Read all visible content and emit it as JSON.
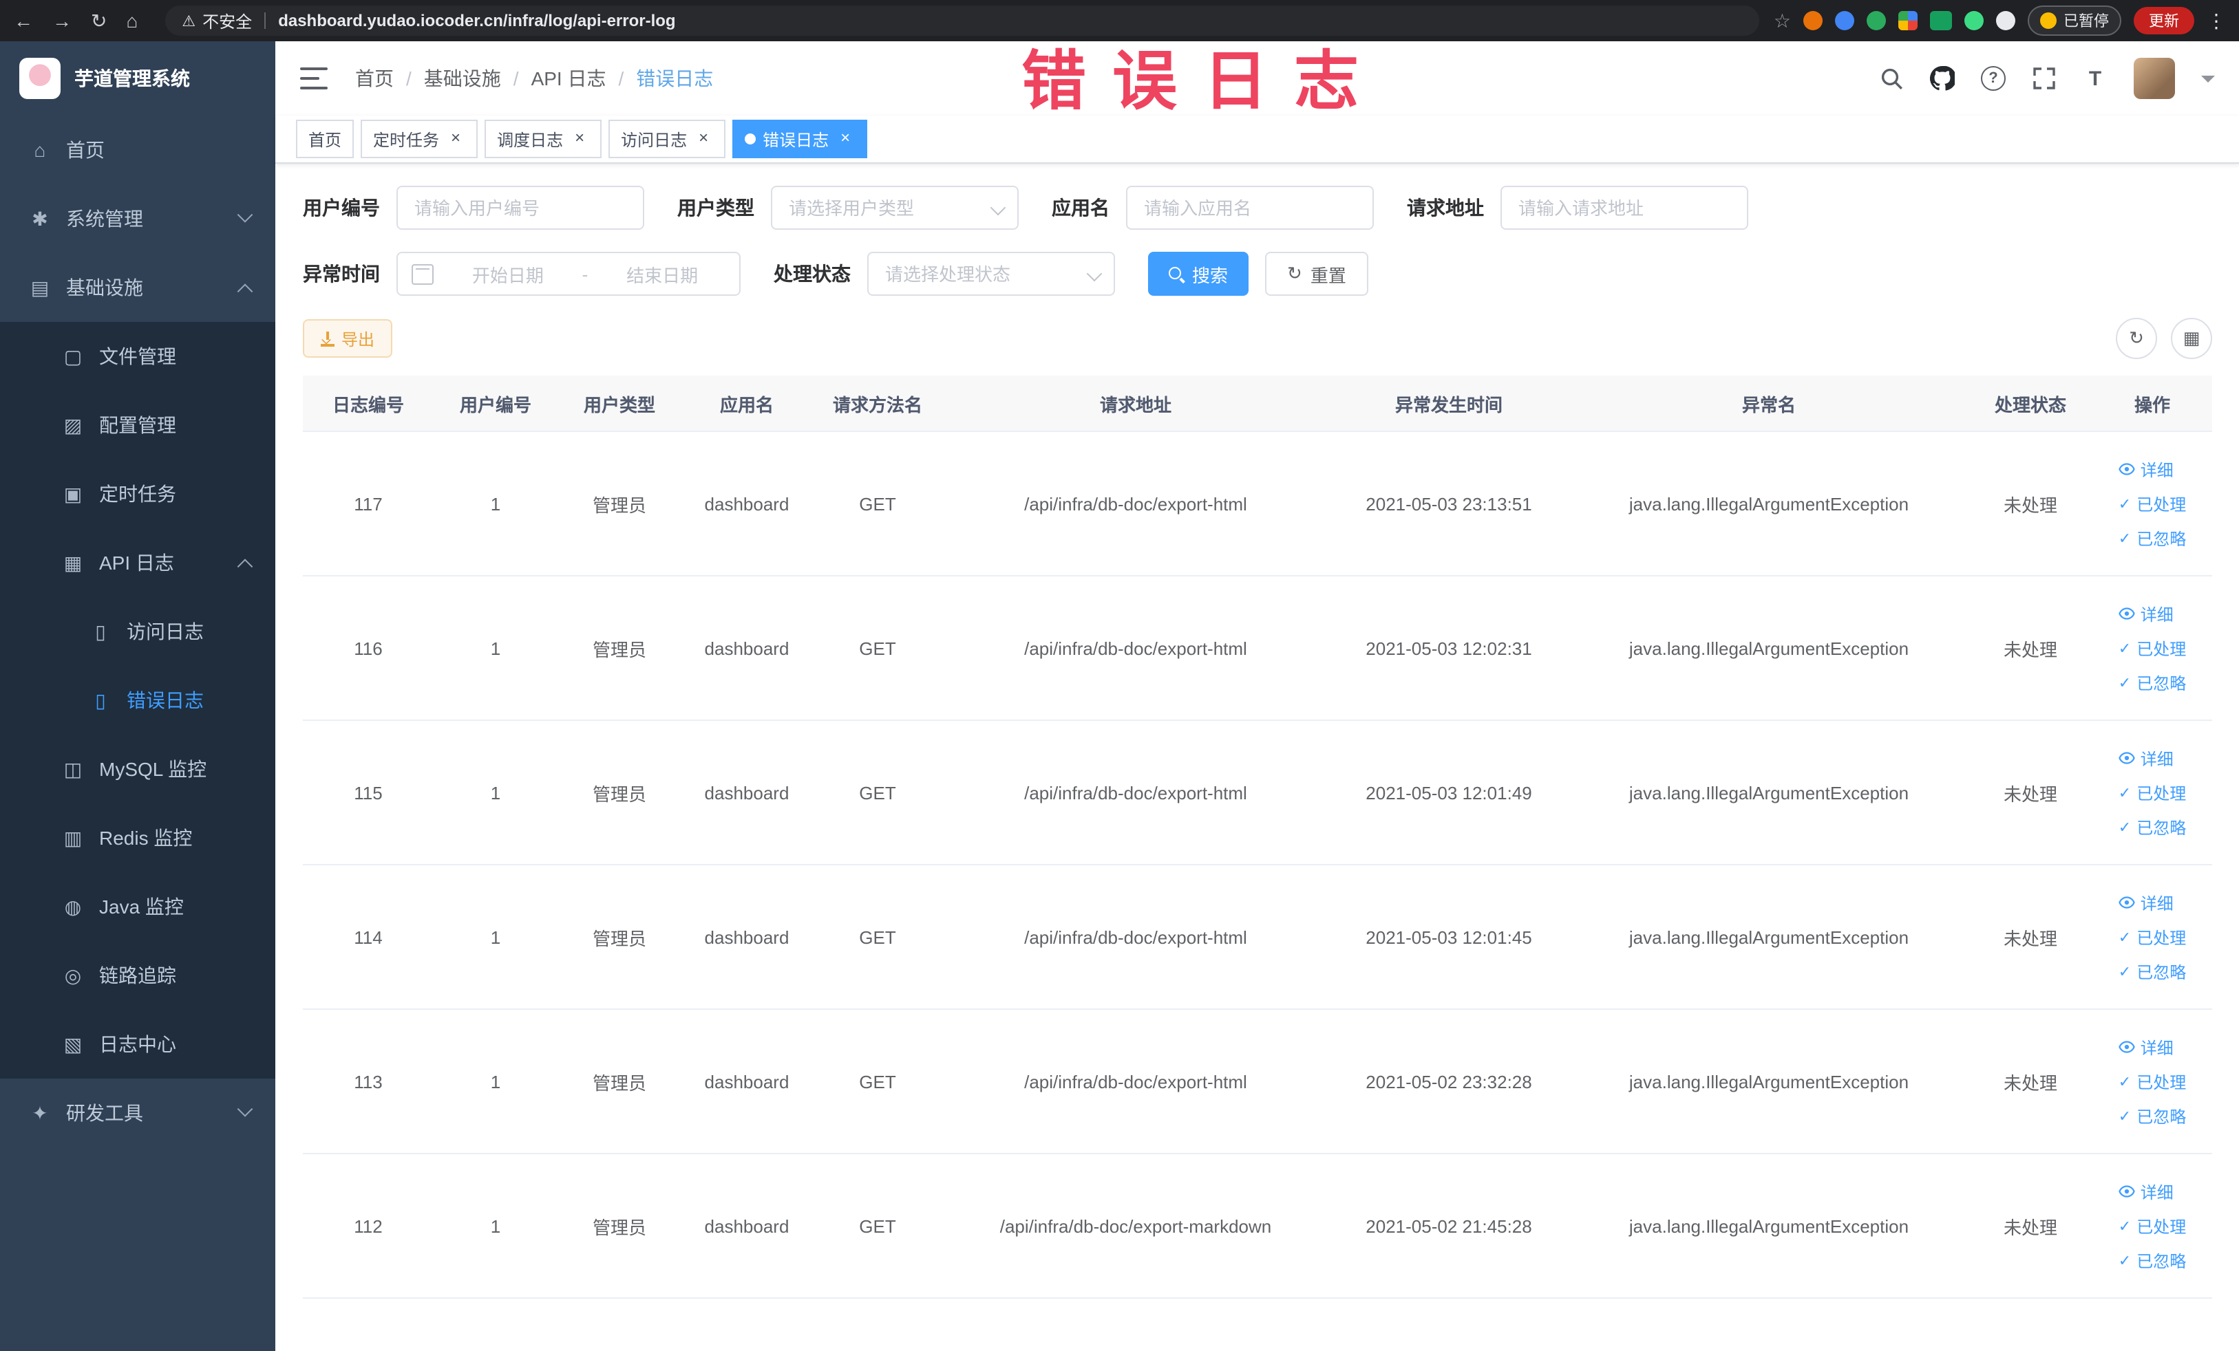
{
  "browser": {
    "security_label": "不安全",
    "url": "dashboard.yudao.iocoder.cn/infra/log/api-error-log",
    "paused_label": "已暂停",
    "update_label": "更新"
  },
  "watermark": "错误日志",
  "sidebar": {
    "logo_title": "芋道管理系统",
    "items": [
      {
        "key": "home",
        "label": "首页",
        "icon": "home-icon",
        "glyph": "home",
        "level": 1
      },
      {
        "key": "system-management",
        "label": "系统管理",
        "icon": "gear-icon",
        "glyph": "gear",
        "level": 1,
        "arrow": "down"
      },
      {
        "key": "infrastructure",
        "label": "基础设施",
        "icon": "infrastructure-icon",
        "glyph": "infra",
        "level": 1,
        "arrow": "up"
      },
      {
        "key": "file-management",
        "label": "文件管理",
        "icon": "file-icon",
        "glyph": "file",
        "level": 2
      },
      {
        "key": "config-management",
        "label": "配置管理",
        "icon": "config-icon",
        "glyph": "config",
        "level": 2
      },
      {
        "key": "scheduled-jobs",
        "label": "定时任务",
        "icon": "job-icon",
        "glyph": "job",
        "level": 2
      },
      {
        "key": "api-log",
        "label": "API 日志",
        "icon": "api-log-icon",
        "glyph": "log",
        "level": 2,
        "arrow": "up"
      },
      {
        "key": "access-log",
        "label": "访问日志",
        "icon": "doc-icon",
        "glyph": "doc",
        "level": 3
      },
      {
        "key": "error-log",
        "label": "错误日志",
        "icon": "doc-icon",
        "glyph": "doc",
        "level": 3,
        "active": true
      },
      {
        "key": "mysql-monitor",
        "label": "MySQL 监控",
        "icon": "mysql-icon",
        "glyph": "mysql",
        "level": 2
      },
      {
        "key": "redis-monitor",
        "label": "Redis 监控",
        "icon": "redis-icon",
        "glyph": "redis",
        "level": 2
      },
      {
        "key": "java-monitor",
        "label": "Java 监控",
        "icon": "java-icon",
        "glyph": "java",
        "level": 2
      },
      {
        "key": "trace",
        "label": "链路追踪",
        "icon": "trace-icon",
        "glyph": "trace",
        "level": 2
      },
      {
        "key": "log-center",
        "label": "日志中心",
        "icon": "log-center-icon",
        "glyph": "center",
        "level": 2
      },
      {
        "key": "dev-tools",
        "label": "研发工具",
        "icon": "tool-icon",
        "glyph": "tool",
        "level": 1,
        "arrow": "down"
      }
    ]
  },
  "header": {
    "breadcrumb": [
      "首页",
      "基础设施",
      "API 日志",
      "错误日志"
    ]
  },
  "tabs": [
    {
      "label": "首页",
      "active": false,
      "closable": false
    },
    {
      "label": "定时任务",
      "active": false,
      "closable": true
    },
    {
      "label": "调度日志",
      "active": false,
      "closable": true
    },
    {
      "label": "访问日志",
      "active": false,
      "closable": true
    },
    {
      "label": "错误日志",
      "active": true,
      "closable": true
    }
  ],
  "filters": {
    "user_id": {
      "label": "用户编号",
      "placeholder": "请输入用户编号"
    },
    "user_type": {
      "label": "用户类型",
      "placeholder": "请选择用户类型"
    },
    "app_name": {
      "label": "应用名",
      "placeholder": "请输入应用名"
    },
    "request_url": {
      "label": "请求地址",
      "placeholder": "请输入请求地址"
    },
    "exception_time": {
      "label": "异常时间",
      "start_placeholder": "开始日期",
      "separator": "-",
      "end_placeholder": "结束日期"
    },
    "process_status": {
      "label": "处理状态",
      "placeholder": "请选择处理状态"
    },
    "search_label": "搜索",
    "reset_label": "重置"
  },
  "toolbar": {
    "export_label": "导出"
  },
  "row_actions": [
    "详细",
    "已处理",
    "已忽略"
  ],
  "table": {
    "columns": [
      "日志编号",
      "用户编号",
      "用户类型",
      "应用名",
      "请求方法名",
      "请求地址",
      "异常发生时间",
      "异常名",
      "处理状态",
      "操作"
    ],
    "rows": [
      {
        "log_id": "117",
        "user_id": "1",
        "user_type": "管理员",
        "app_name": "dashboard",
        "method": "GET",
        "url": "/api/infra/db-doc/export-html",
        "time": "2021-05-03 23:13:51",
        "exception": "java.lang.IllegalArgumentException",
        "status": "未处理"
      },
      {
        "log_id": "116",
        "user_id": "1",
        "user_type": "管理员",
        "app_name": "dashboard",
        "method": "GET",
        "url": "/api/infra/db-doc/export-html",
        "time": "2021-05-03 12:02:31",
        "exception": "java.lang.IllegalArgumentException",
        "status": "未处理"
      },
      {
        "log_id": "115",
        "user_id": "1",
        "user_type": "管理员",
        "app_name": "dashboard",
        "method": "GET",
        "url": "/api/infra/db-doc/export-html",
        "time": "2021-05-03 12:01:49",
        "exception": "java.lang.IllegalArgumentException",
        "status": "未处理"
      },
      {
        "log_id": "114",
        "user_id": "1",
        "user_type": "管理员",
        "app_name": "dashboard",
        "method": "GET",
        "url": "/api/infra/db-doc/export-html",
        "time": "2021-05-03 12:01:45",
        "exception": "java.lang.IllegalArgumentException",
        "status": "未处理"
      },
      {
        "log_id": "113",
        "user_id": "1",
        "user_type": "管理员",
        "app_name": "dashboard",
        "method": "GET",
        "url": "/api/infra/db-doc/export-html",
        "time": "2021-05-02 23:32:28",
        "exception": "java.lang.IllegalArgumentException",
        "status": "未处理"
      },
      {
        "log_id": "112",
        "user_id": "1",
        "user_type": "管理员",
        "app_name": "dashboard",
        "method": "GET",
        "url": "/api/infra/db-doc/export-markdown",
        "time": "2021-05-02 21:45:28",
        "exception": "java.lang.IllegalArgumentException",
        "status": "未处理"
      }
    ]
  }
}
